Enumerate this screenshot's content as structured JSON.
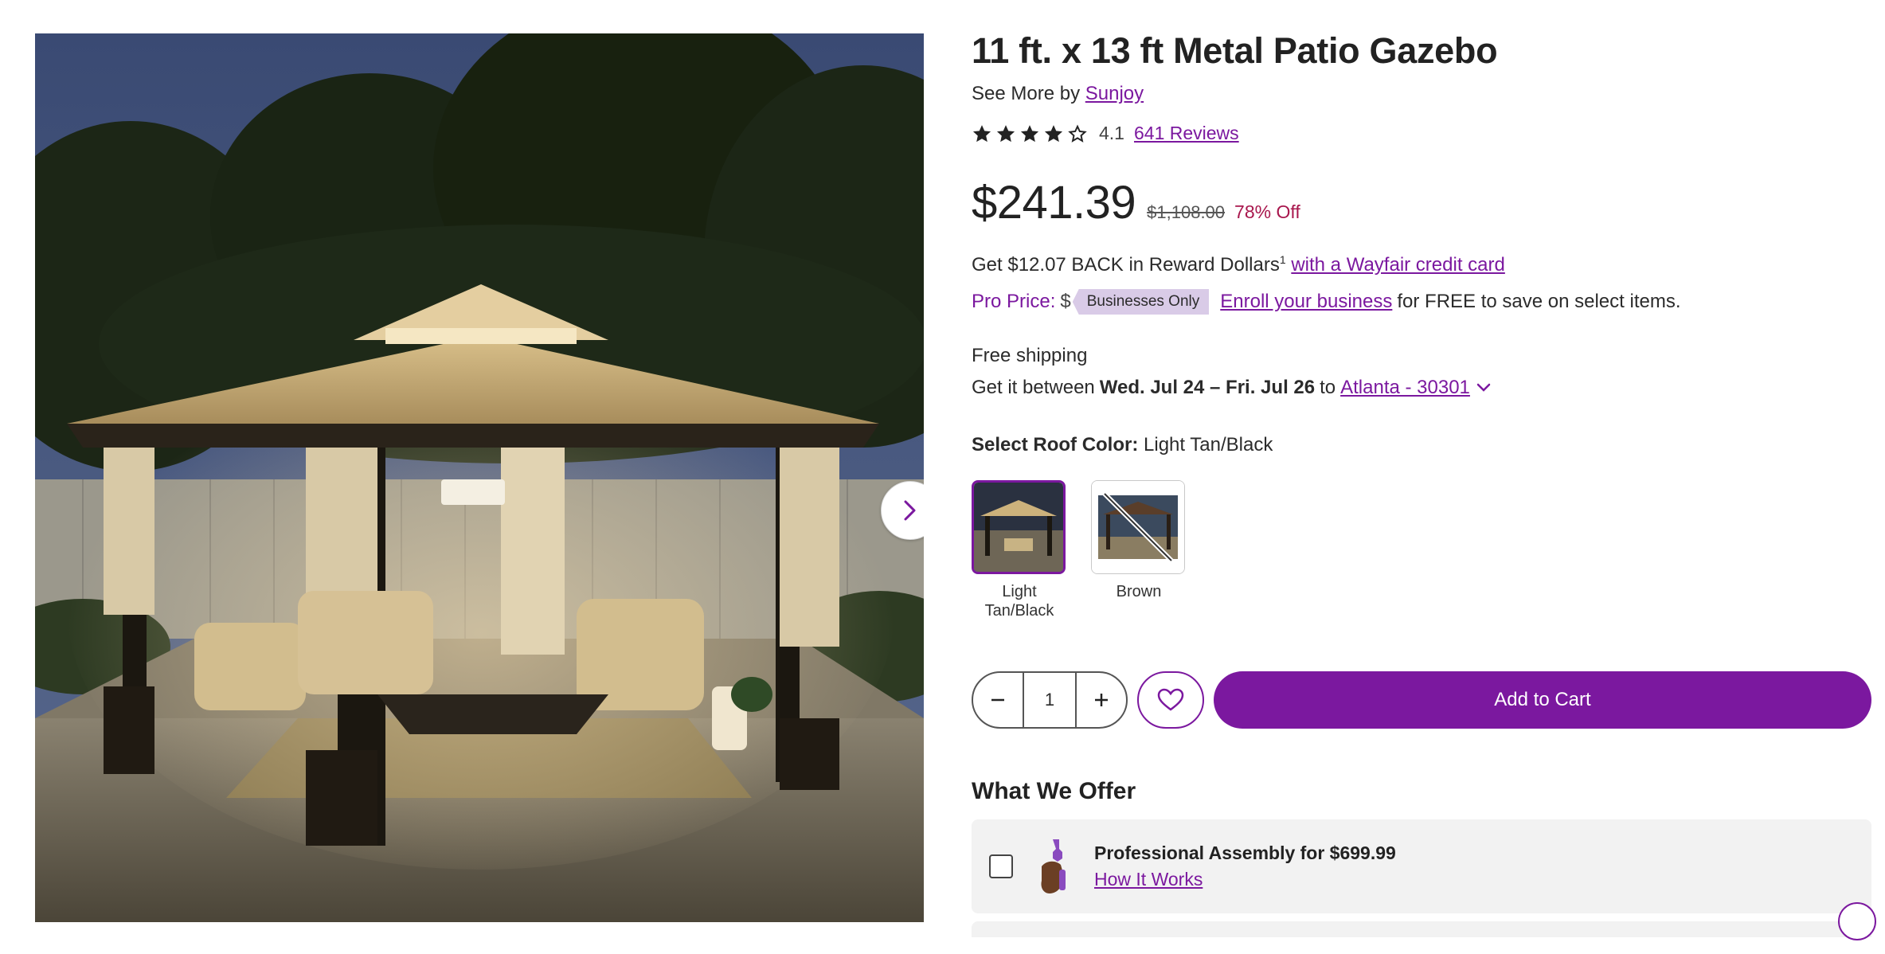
{
  "product": {
    "title": "11 ft. x 13 ft Metal Patio Gazebo",
    "see_more_prefix": "See More by",
    "brand": "Sunjoy",
    "rating": "4.1",
    "rating_fraction": 0.82,
    "reviews_link": "641 Reviews"
  },
  "pricing": {
    "price": "$241.39",
    "original": "$1,108.00",
    "discount": "78% Off"
  },
  "reward": {
    "text": "Get $12.07 BACK in Reward Dollars",
    "footnote": "1",
    "link": "with a Wayfair credit card"
  },
  "pro": {
    "label": "Pro Price:",
    "dollar": "$",
    "badge": "Businesses Only",
    "link": "Enroll your business",
    "suffix": "for FREE to save on select items."
  },
  "shipping": {
    "free": "Free shipping",
    "prefix": "Get it between",
    "dates": "Wed. Jul 24 – Fri. Jul 26",
    "to": "to",
    "location": "Atlanta - 30301"
  },
  "color": {
    "label": "Select Roof Color:",
    "selected": "Light Tan/Black",
    "options": [
      {
        "name": "Light Tan/Black",
        "selected": true
      },
      {
        "name": "Brown",
        "selected": false,
        "unavailable": true
      }
    ]
  },
  "cart": {
    "quantity": "1",
    "add_label": "Add to Cart"
  },
  "offer": {
    "heading": "What We Offer",
    "assembly_title": "Professional Assembly for $699.99",
    "assembly_link": "How It Works"
  },
  "icons": [
    "chevron-right-icon",
    "star-icon",
    "chevron-down-icon",
    "minus-icon",
    "plus-icon",
    "heart-icon",
    "wrench-hand-icon"
  ],
  "colors": {
    "accent": "#7b189f",
    "discount": "#a8174d",
    "badge": "#d9cbe7"
  }
}
